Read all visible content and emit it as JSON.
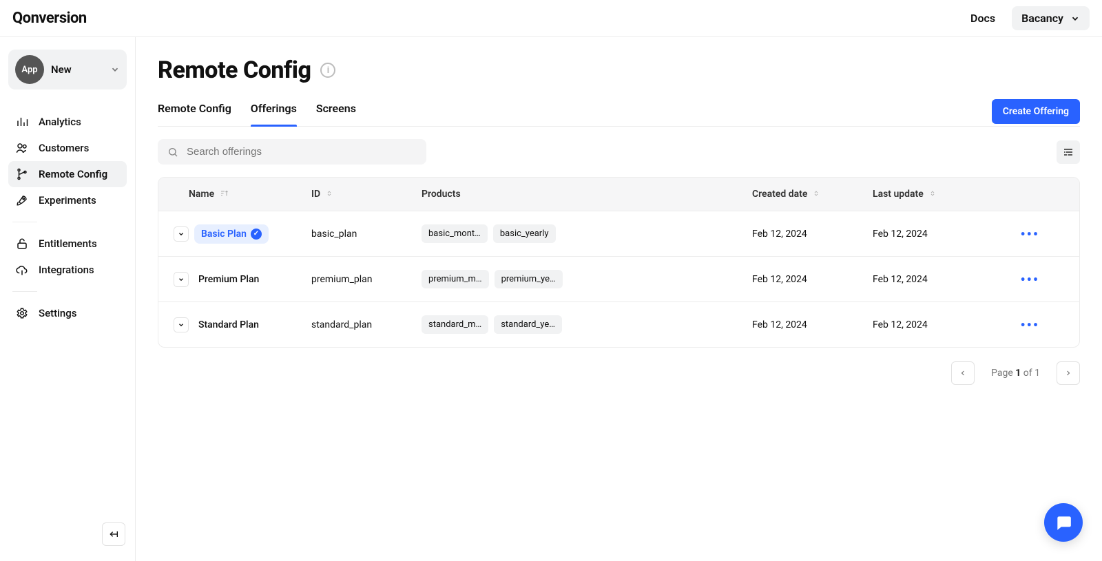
{
  "topbar": {
    "logo": "Qonversion",
    "docs_label": "Docs",
    "org_label": "Bacancy"
  },
  "sidebar": {
    "app_avatar_label": "App",
    "app_name": "New",
    "items": [
      {
        "id": "analytics",
        "label": "Analytics"
      },
      {
        "id": "customers",
        "label": "Customers"
      },
      {
        "id": "remote-config",
        "label": "Remote Config"
      },
      {
        "id": "experiments",
        "label": "Experiments"
      }
    ],
    "items2": [
      {
        "id": "entitlements",
        "label": "Entitlements"
      },
      {
        "id": "integrations",
        "label": "Integrations"
      }
    ],
    "items3": [
      {
        "id": "settings",
        "label": "Settings"
      }
    ]
  },
  "page": {
    "title": "Remote Config",
    "tabs": [
      {
        "id": "remote-config",
        "label": "Remote Config"
      },
      {
        "id": "offerings",
        "label": "Offerings"
      },
      {
        "id": "screens",
        "label": "Screens"
      }
    ],
    "create_button": "Create Offering",
    "search_placeholder": "Search offerings"
  },
  "table": {
    "columns": {
      "name": "Name",
      "id": "ID",
      "products": "Products",
      "created": "Created date",
      "updated": "Last update"
    },
    "rows": [
      {
        "name": "Basic Plan",
        "highlighted": true,
        "id": "basic_plan",
        "products": [
          "basic_mont…",
          "basic_yearly"
        ],
        "created": "Feb 12, 2024",
        "updated": "Feb 12, 2024"
      },
      {
        "name": "Premium Plan",
        "highlighted": false,
        "id": "premium_plan",
        "products": [
          "premium_m…",
          "premium_ye…"
        ],
        "created": "Feb 12, 2024",
        "updated": "Feb 12, 2024"
      },
      {
        "name": "Standard Plan",
        "highlighted": false,
        "id": "standard_plan",
        "products": [
          "standard_m…",
          "standard_ye…"
        ],
        "created": "Feb 12, 2024",
        "updated": "Feb 12, 2024"
      }
    ]
  },
  "pagination": {
    "prefix": "Page",
    "current": "1",
    "of_word": "of",
    "total": "1"
  }
}
